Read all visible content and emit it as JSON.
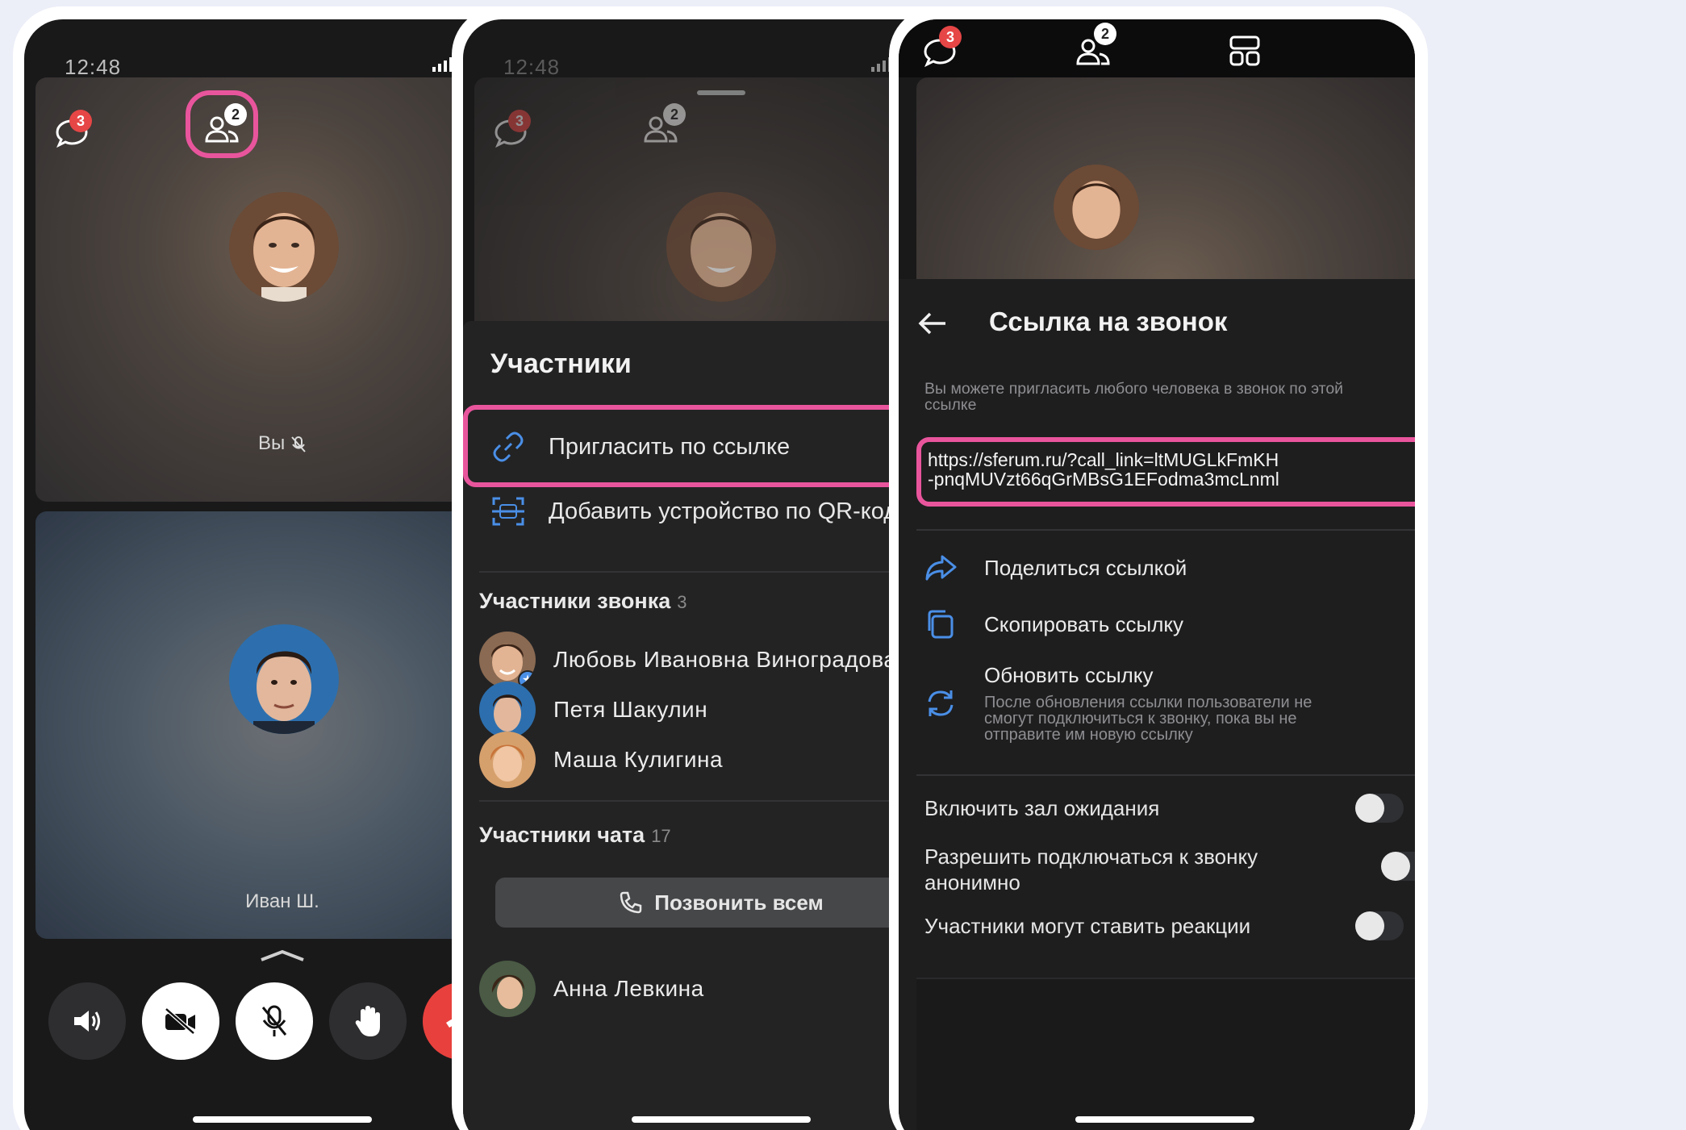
{
  "screen1": {
    "time": "12:48",
    "chat_badge": "3",
    "participants_badge": "2",
    "self_label": "Вы",
    "other_label": "Иван Ш."
  },
  "screen2": {
    "time": "12:48",
    "chat_badge": "3",
    "participants_badge": "2",
    "title": "Участники",
    "invite_label": "Пригласить по ссылке",
    "qr_label": "Добавить устройство по QR-коду",
    "call_section": "Участники звонка",
    "call_count": "3",
    "call_members": [
      {
        "name": "Любовь Ивановна Виноградова"
      },
      {
        "name": "Петя Шакулин"
      },
      {
        "name": "Маша Кулигина"
      }
    ],
    "chat_section": "Участники чата",
    "chat_count": "17",
    "call_all": "Позвонить всем",
    "chat_members": [
      {
        "name": "Анна Левкина"
      }
    ]
  },
  "screen3": {
    "chat_badge": "3",
    "participants_badge": "2",
    "title": "Ссылка на звонок",
    "note": "Вы можете пригласить любого человека в звонок по этой ссылке",
    "link_line1": "https://sferum.ru/?call_link=ltMUGLkFmKH",
    "link_line2": "-pnqMUVzt66qGrMBsG1EFodma3mcLnml",
    "share": "Поделиться ссылкой",
    "copy": "Скопировать ссылку",
    "refresh": "Обновить ссылку",
    "refresh_note": "После обновления ссылки пользователи не смогут подключиться к звонку, пока вы не отправите им новую ссылку",
    "waiting_room": "Включить зал ожидания",
    "anonymous": "Разрешить подключаться к звонку анонимно",
    "reactions": "Участники могут ставить реакции"
  },
  "colors": {
    "highlight": "#e9559d",
    "badge": "#e64646",
    "end_call": "#e8413d",
    "accent_blue": "#4a8fe7"
  },
  "icons": [
    "chat-icon",
    "participants-icon",
    "layout-icon",
    "speaker-icon",
    "camera-off-icon",
    "mic-off-icon",
    "hand-icon",
    "end-call-icon",
    "link-icon",
    "qr-icon",
    "search-icon",
    "back-icon",
    "share-icon",
    "copy-icon",
    "refresh-icon",
    "phone-icon",
    "plus-icon"
  ]
}
